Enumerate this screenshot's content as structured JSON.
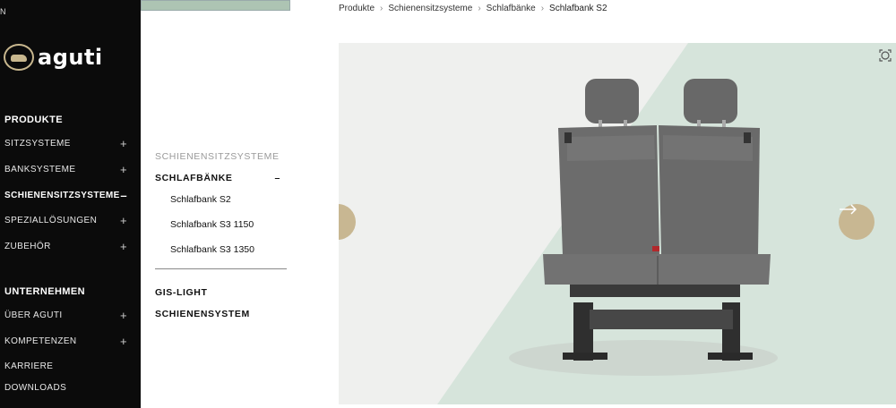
{
  "sidebar": {
    "top_letter": "N",
    "logo_text": "aguti",
    "sections": {
      "products_title": "PRODUKTE",
      "company_title": "UNTERNEHMEN"
    },
    "products": [
      {
        "label": "SITZSYSTEME",
        "toggle": "+"
      },
      {
        "label": "BANKSYSTEME",
        "toggle": "+"
      },
      {
        "label": "SCHIENENSITZSYSTEME",
        "toggle": "–"
      },
      {
        "label": "SPEZIALLÖSUNGEN",
        "toggle": "+"
      },
      {
        "label": "ZUBEHÖR",
        "toggle": "+"
      }
    ],
    "company": [
      {
        "label": "ÜBER AGUTI",
        "toggle": "+"
      },
      {
        "label": "KOMPETENZEN",
        "toggle": "+"
      },
      {
        "label": "KARRIERE",
        "toggle": ""
      },
      {
        "label": "DOWNLOADS",
        "toggle": ""
      }
    ]
  },
  "subnav": {
    "category": "SCHIENENSITZSYSTEME",
    "active_group": "SCHLAFBÄNKE",
    "active_toggle": "–",
    "items": [
      "Schlafbank S2",
      "Schlafbank S3 1150",
      "Schlafbank S3 1350"
    ],
    "other_groups": [
      "GIS-LIGHT",
      "SCHIENENSYSTEM"
    ]
  },
  "breadcrumb": {
    "items": [
      "Produkte",
      "Schienensitzsysteme",
      "Schlafbänke",
      "Schlafbank S2"
    ],
    "separator": "›"
  },
  "gallery": {
    "accent_color": "#c8b792",
    "background_color": "#eff0ee",
    "shape_color": "#d6e4db",
    "prev_icon": "arrow-left-icon",
    "next_icon": "arrow-right-icon",
    "zoom_icon": "zoom-icon"
  }
}
